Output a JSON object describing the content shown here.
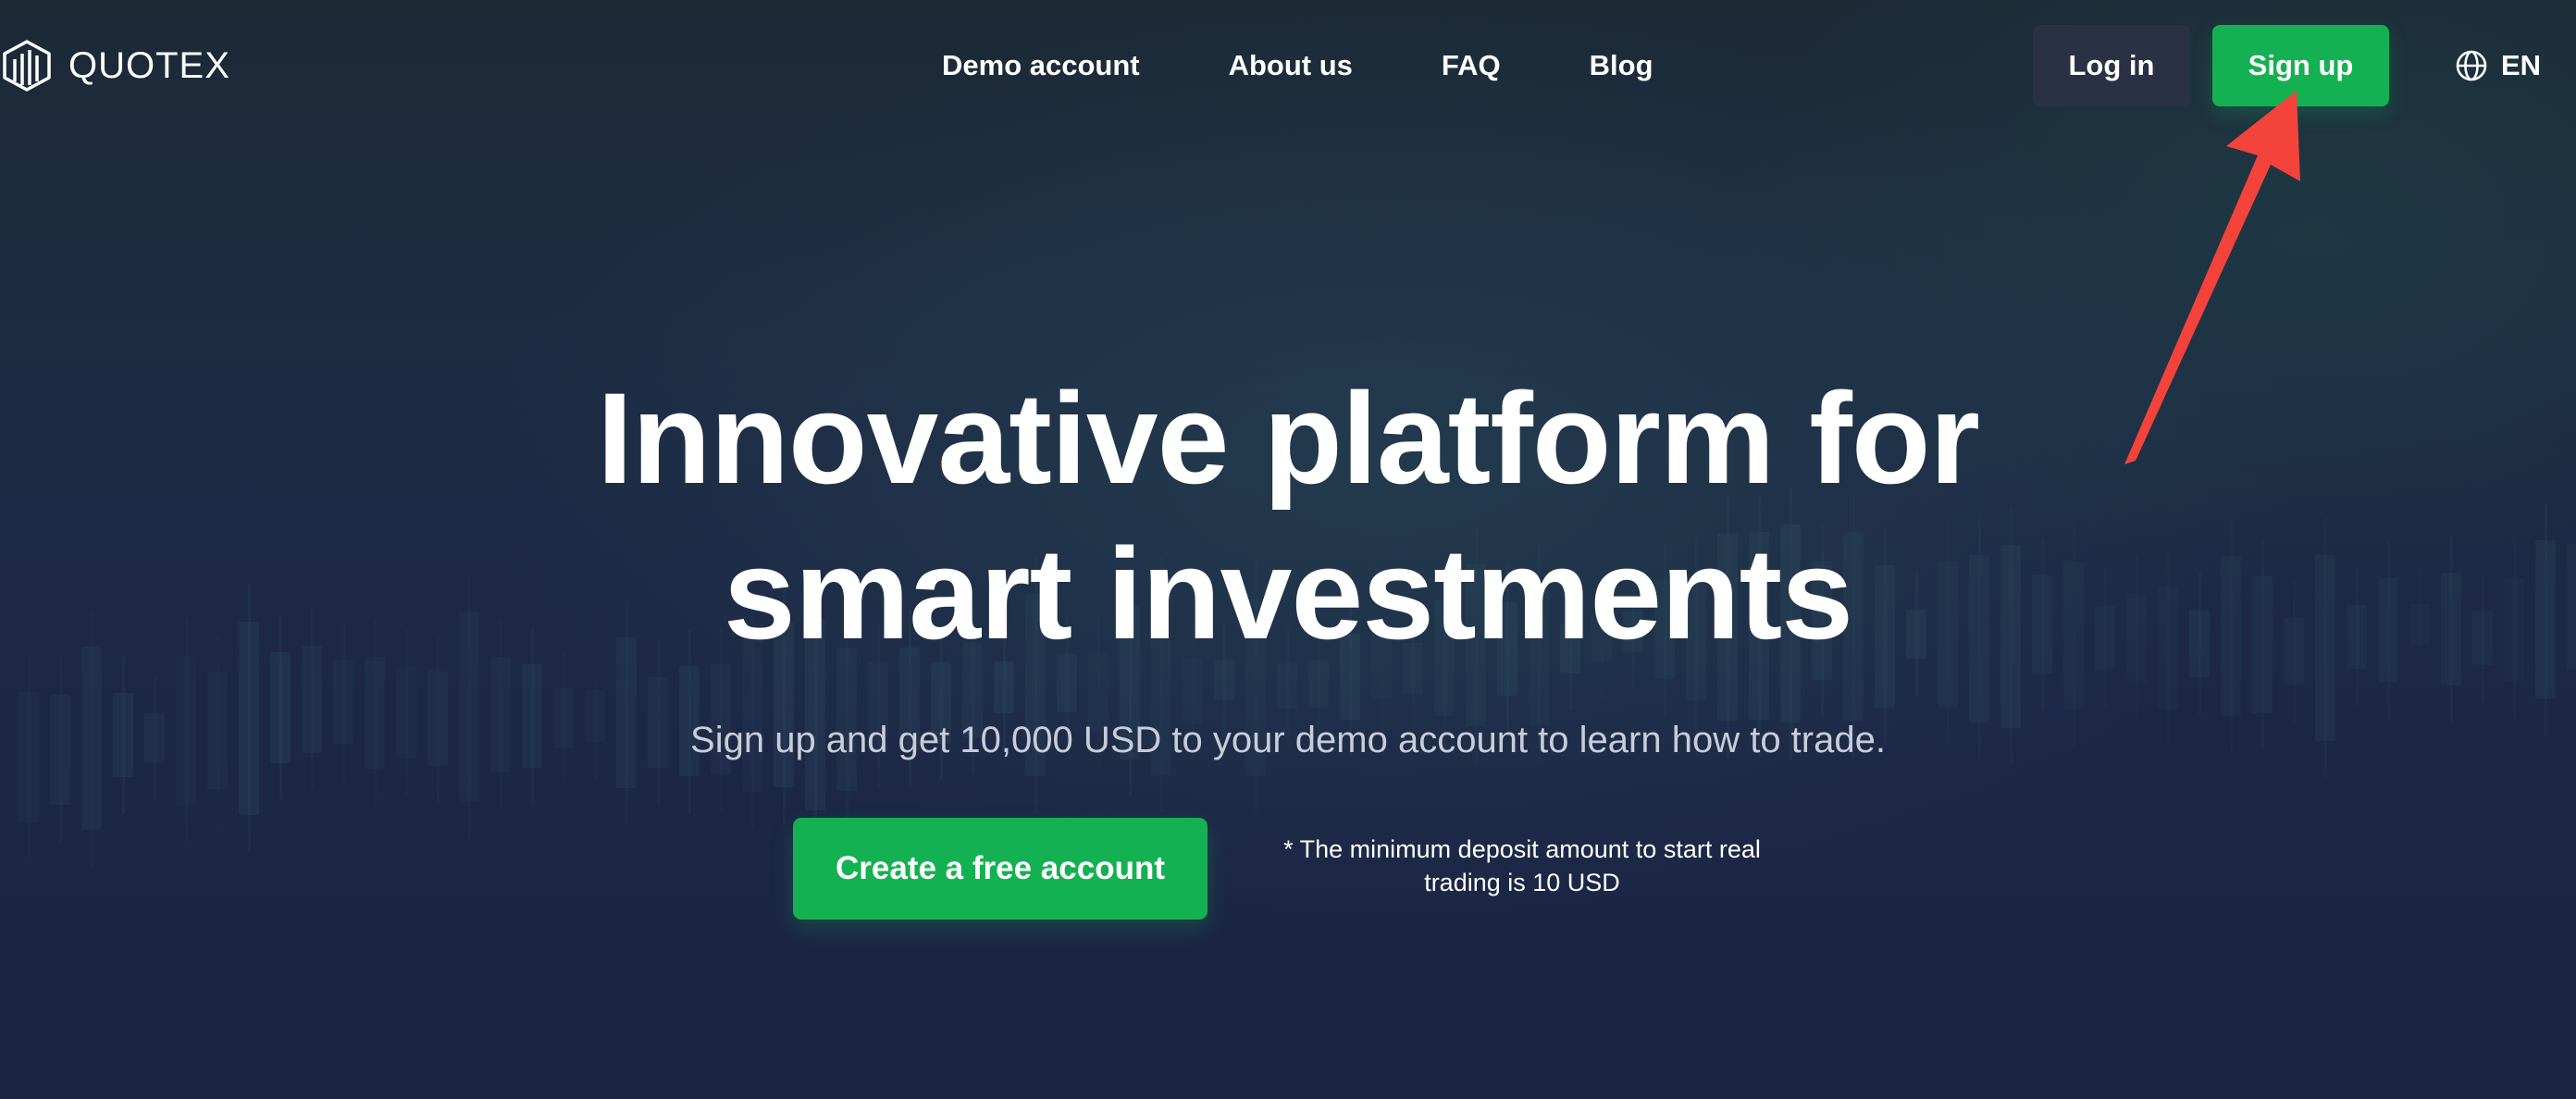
{
  "brand": {
    "name": "QUOTEX",
    "icon": "quotex-logo-icon"
  },
  "nav": {
    "items": [
      {
        "label": "Demo account"
      },
      {
        "label": "About us"
      },
      {
        "label": "FAQ"
      },
      {
        "label": "Blog"
      }
    ]
  },
  "auth": {
    "login_label": "Log in",
    "signup_label": "Sign up"
  },
  "language": {
    "icon": "globe-icon",
    "code": "EN"
  },
  "hero": {
    "title_line1": "Innovative platform for",
    "title_line2": "smart investments",
    "subtitle": "Sign up and get 10,000 USD to your demo account to learn how to trade.",
    "cta_label": "Create a free account",
    "note_line1": "* The minimum deposit amount to start real",
    "note_line2": "trading is 10 USD"
  },
  "annotation": {
    "type": "arrow",
    "target": "signup-button",
    "color": "#f4433b"
  },
  "colors": {
    "accent_green": "#14b152",
    "login_bg": "#2b3144",
    "page_bg": "#1b2540"
  }
}
